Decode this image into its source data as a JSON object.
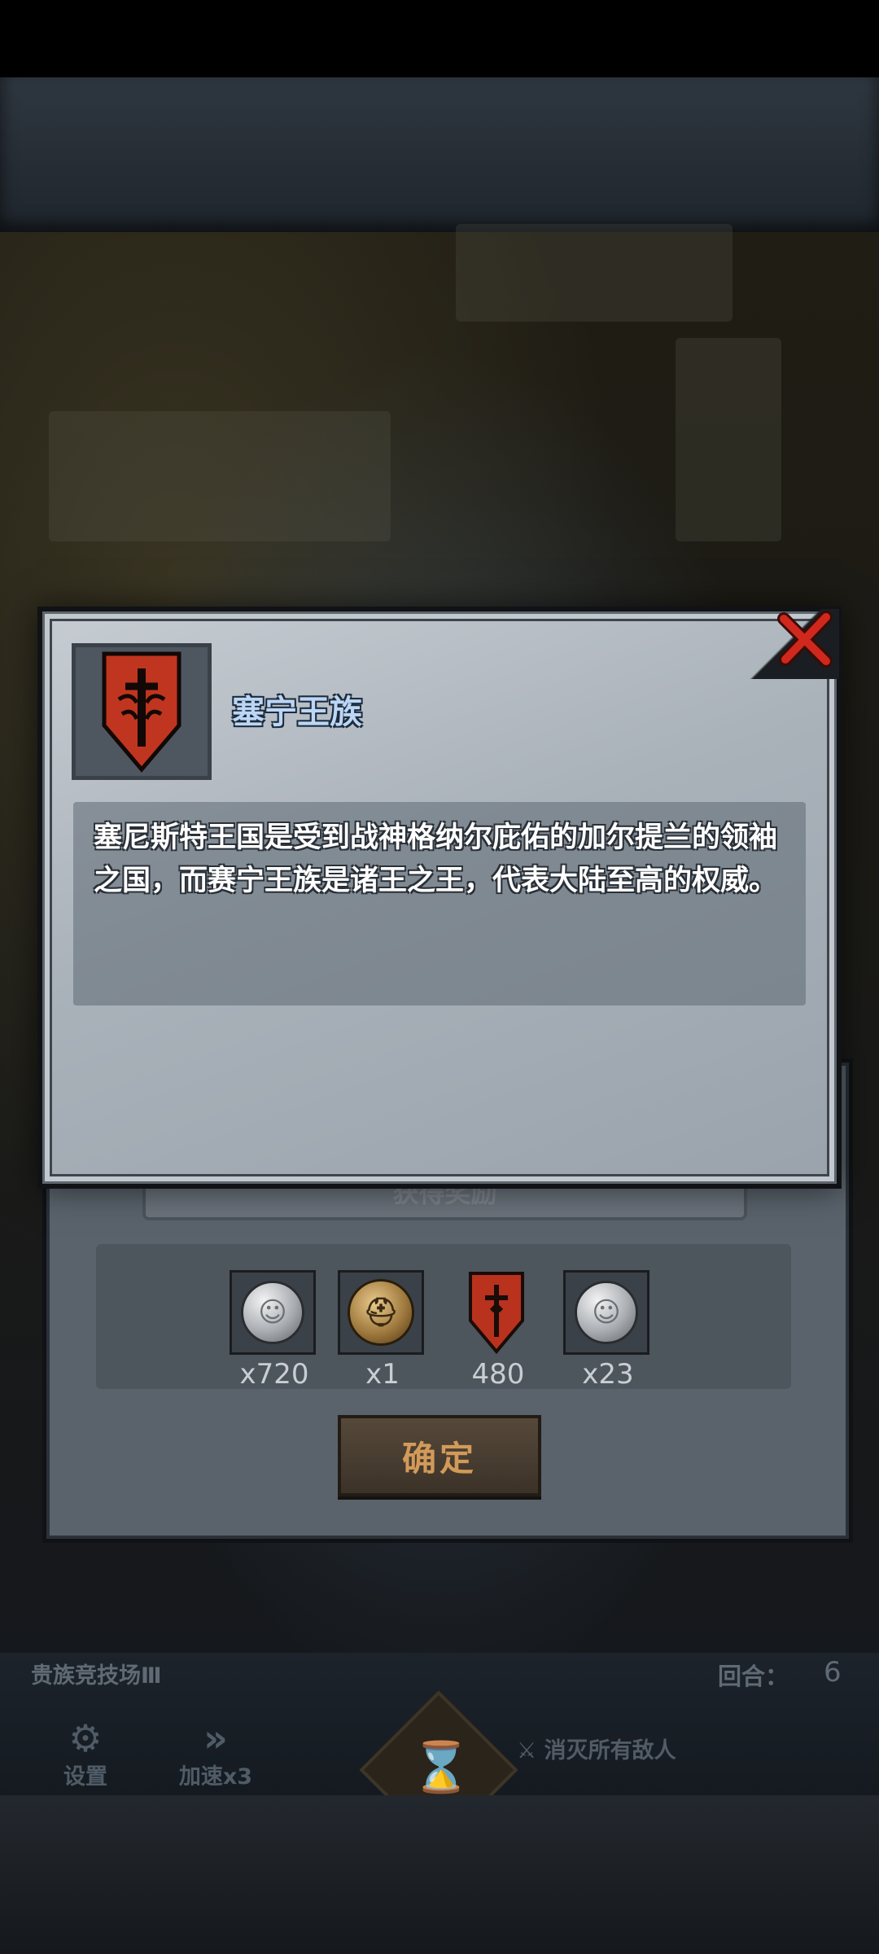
{
  "background": {
    "stage_name": "贵族竞技场Ⅲ",
    "round_label": "回合：",
    "round_value": "6",
    "buttons": {
      "settings": "设置",
      "speed": "加速x3",
      "objective": "消灭所有敌人"
    },
    "tab_label": "获得奖励"
  },
  "info_dialog": {
    "title": "塞宁王族",
    "description": "塞尼斯特王国是受到战神格纳尔庇佑的加尔提兰的领袖之国，而赛宁王族是诸王之王，代表大陆至高的权威。",
    "emblem_icon": "red-sword-shield-emblem",
    "close_icon": "red-x-close"
  },
  "reward_dialog": {
    "rewards": [
      {
        "icon": "silver-coin",
        "count": "x720"
      },
      {
        "icon": "bronze-helmet-medal",
        "count": "x1"
      },
      {
        "icon": "red-shield-emblem",
        "count": "480"
      },
      {
        "icon": "silver-coin",
        "count": "x23"
      }
    ],
    "confirm_label": "确定"
  },
  "colors": {
    "title_blue": "#bcd6f5",
    "confirm_text": "#d29a59",
    "emblem_red": "#c0351f",
    "close_red": "#c8261c"
  }
}
